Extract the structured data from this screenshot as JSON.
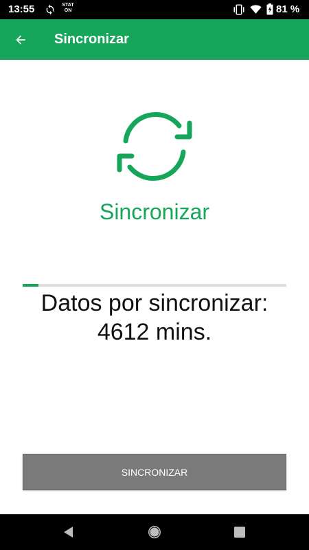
{
  "status_bar": {
    "time": "13:55",
    "stat_on_line1": "STAT",
    "stat_on_line2": "ON",
    "battery": "81 %",
    "icons": [
      "sync-icon",
      "stat-on-icon",
      "vibrate-icon",
      "wifi-icon",
      "battery-icon"
    ]
  },
  "app_bar": {
    "back_icon": "arrow-left-icon",
    "title": "Sincronizar",
    "color": "#16a65a"
  },
  "main": {
    "hero_icon": "sync-icon",
    "title": "Sincronizar",
    "progress": 0.06,
    "pending_line1": "Datos por sincronizar:",
    "pending_line2": "4612 mins."
  },
  "footer": {
    "button_label": "SINCRONIZAR"
  },
  "nav_bar": {
    "icons": [
      "back-triangle-icon",
      "home-circle-icon",
      "recents-square-icon"
    ]
  },
  "colors": {
    "accent": "#16a65a",
    "button_disabled": "#7a7a7a"
  }
}
